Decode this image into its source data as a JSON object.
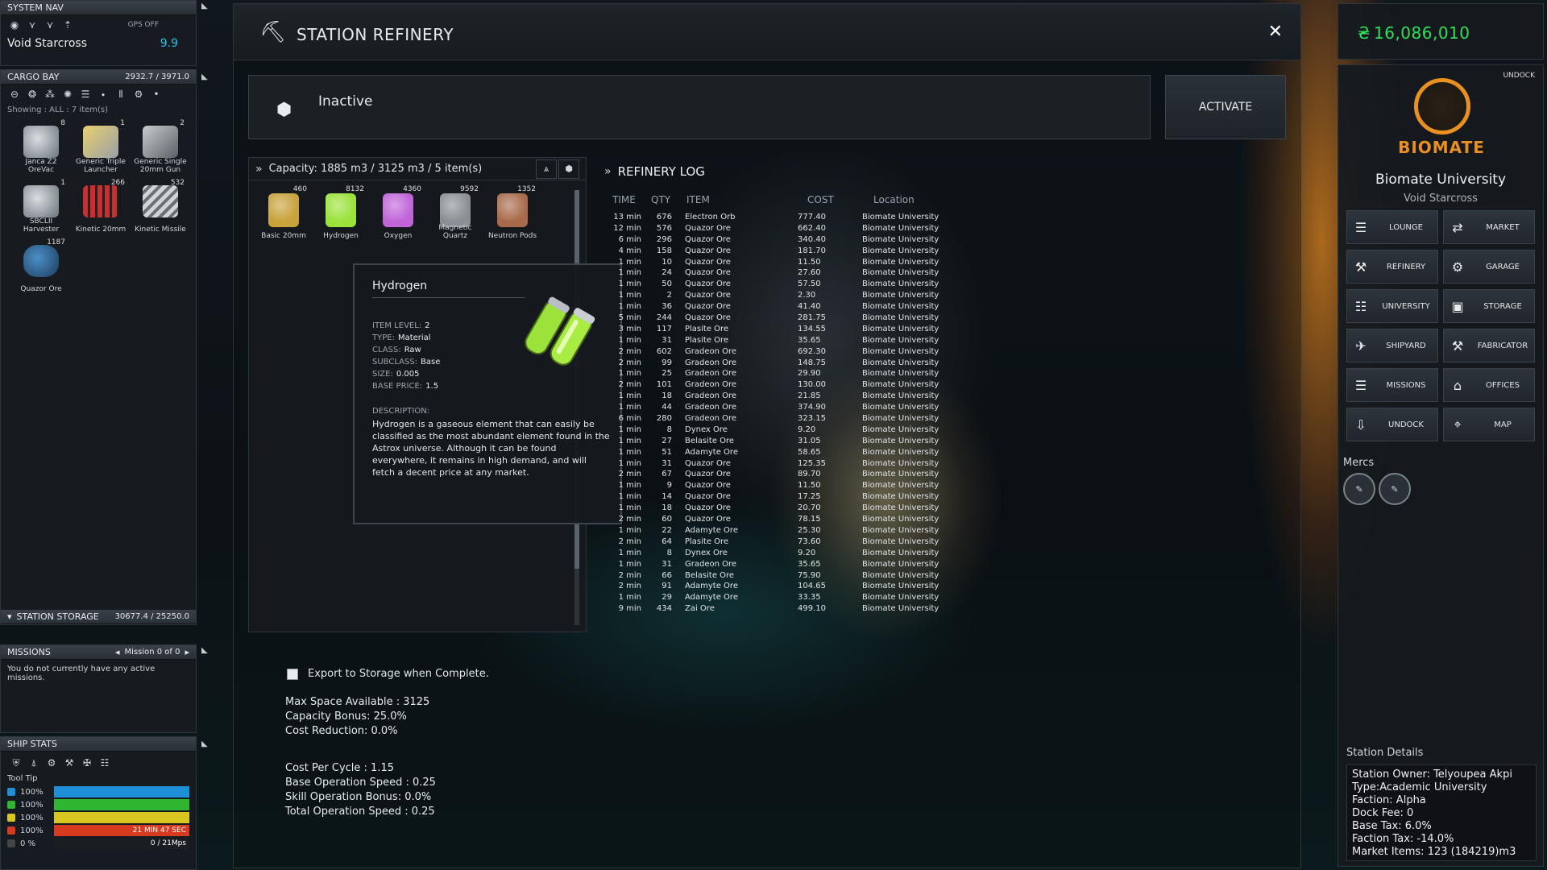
{
  "system_nav": {
    "title": "SYSTEM NAV",
    "gps": "GPS OFF",
    "location": "Void Starcross",
    "security": "9.9"
  },
  "cargo_bay": {
    "title": "CARGO BAY",
    "capacity": "2932.7 / 3971.0",
    "showing": "Showing : ALL : 7 item(s)",
    "items": [
      {
        "name": "Janca Z2 OreVac",
        "count": "8"
      },
      {
        "name": "Generic Triple Launcher",
        "count": "1"
      },
      {
        "name": "Generic Single 20mm Gun",
        "count": "2"
      },
      {
        "name": "SBCLII Harvester",
        "count": "1"
      },
      {
        "name": "Kinetic 20mm",
        "count": "266"
      },
      {
        "name": "Kinetic Missile",
        "count": "532"
      },
      {
        "name": "Quazor Ore",
        "count": "1187"
      }
    ]
  },
  "station_storage": {
    "title": "STATION STORAGE",
    "capacity": "30677.4 / 25250.0"
  },
  "missions": {
    "title": "MISSIONS",
    "counter": "Mission 0 of 0",
    "message": "You do not currently have any active missions."
  },
  "ship_stats": {
    "title": "SHIP STATS",
    "tooltip_label": "Tool Tip",
    "bars": [
      {
        "pct": "100%",
        "color": "#1f8fd8",
        "fill": 1.0,
        "text": ""
      },
      {
        "pct": "100%",
        "color": "#2fb52f",
        "fill": 1.0,
        "text": ""
      },
      {
        "pct": "100%",
        "color": "#d8c51f",
        "fill": 1.0,
        "text": ""
      },
      {
        "pct": "100%",
        "color": "#d63a1f",
        "fill": 1.0,
        "text": "21 MIN 47 SEC"
      },
      {
        "pct": "0 %",
        "color": "#444",
        "fill": 0.0,
        "text": "0 / 21Mps"
      }
    ]
  },
  "refinery": {
    "title": "STATION REFINERY",
    "status": "Inactive",
    "activate_label": "ACTIVATE",
    "capacity": "Capacity: 1885 m3 / 3125 m3 / 5 item(s)",
    "items": [
      {
        "name": "Basic 20mm",
        "count": "460",
        "color": "#c8a23a"
      },
      {
        "name": "Hydrogen",
        "count": "8132",
        "color": "#9be23a"
      },
      {
        "name": "Oxygen",
        "count": "4360",
        "color": "#c064d8"
      },
      {
        "name": "Magnetic Quartz",
        "count": "9592",
        "color": "#8a8f95"
      },
      {
        "name": "Neutron Pods",
        "count": "1352",
        "color": "#a86a4a"
      }
    ],
    "export_label": "Export to Storage when Complete.",
    "stats": [
      "Max Space Available : 3125",
      "Capacity Bonus: 25.0%",
      "Cost Reduction: 0.0%"
    ],
    "stats2": [
      "Cost Per Cycle : 1.15",
      "Base Operation Speed : 0.25",
      "Skill Operation Bonus: 0.0%",
      "Total Operation Speed : 0.25"
    ]
  },
  "tooltip": {
    "title": "Hydrogen",
    "fields": [
      {
        "k": "ITEM LEVEL:",
        "v": "2"
      },
      {
        "k": "TYPE:",
        "v": "Material"
      },
      {
        "k": "CLASS:",
        "v": "Raw"
      },
      {
        "k": "SUBCLASS:",
        "v": "Base"
      },
      {
        "k": "SIZE:",
        "v": "0.005"
      },
      {
        "k": "BASE PRICE:",
        "v": "1.5"
      }
    ],
    "desc_label": "DESCRIPTION:",
    "description": "Hydrogen is a gaseous element that can easily be classified as the most abundant element found in the Astrox universe. Although it can be found everywhere, it remains in high demand, and will fetch a decent price at any market."
  },
  "log": {
    "title": "REFINERY LOG",
    "headers": [
      "TIME",
      "QTY",
      "ITEM",
      "COST",
      "Location"
    ],
    "rows": [
      [
        "13 min",
        "676",
        "Electron Orb",
        "777.40",
        "Biomate University"
      ],
      [
        "12 min",
        "576",
        "Quazor Ore",
        "662.40",
        "Biomate University"
      ],
      [
        "6 min",
        "296",
        "Quazor Ore",
        "340.40",
        "Biomate University"
      ],
      [
        "4 min",
        "158",
        "Quazor Ore",
        "181.70",
        "Biomate University"
      ],
      [
        "1 min",
        "10",
        "Quazor Ore",
        "11.50",
        "Biomate University"
      ],
      [
        "1 min",
        "24",
        "Quazor Ore",
        "27.60",
        "Biomate University"
      ],
      [
        "1 min",
        "50",
        "Quazor Ore",
        "57.50",
        "Biomate University"
      ],
      [
        "1 min",
        "2",
        "Quazor Ore",
        "2.30",
        "Biomate University"
      ],
      [
        "1 min",
        "36",
        "Quazor Ore",
        "41.40",
        "Biomate University"
      ],
      [
        "5 min",
        "244",
        "Quazor Ore",
        "281.75",
        "Biomate University"
      ],
      [
        "3 min",
        "117",
        "Plasite Ore",
        "134.55",
        "Biomate University"
      ],
      [
        "1 min",
        "31",
        "Plasite Ore",
        "35.65",
        "Biomate University"
      ],
      [
        "2 min",
        "602",
        "Gradeon Ore",
        "692.30",
        "Biomate University"
      ],
      [
        "2 min",
        "99",
        "Gradeon Ore",
        "148.75",
        "Biomate University"
      ],
      [
        "1 min",
        "25",
        "Gradeon Ore",
        "29.90",
        "Biomate University"
      ],
      [
        "2 min",
        "101",
        "Gradeon Ore",
        "130.00",
        "Biomate University"
      ],
      [
        "1 min",
        "18",
        "Gradeon Ore",
        "21.85",
        "Biomate University"
      ],
      [
        "1 min",
        "44",
        "Gradeon Ore",
        "374.90",
        "Biomate University"
      ],
      [
        "6 min",
        "280",
        "Gradeon Ore",
        "323.15",
        "Biomate University"
      ],
      [
        "1 min",
        "8",
        "Dynex Ore",
        "9.20",
        "Biomate University"
      ],
      [
        "1 min",
        "27",
        "Belasite Ore",
        "31.05",
        "Biomate University"
      ],
      [
        "1 min",
        "51",
        "Adamyte Ore",
        "58.65",
        "Biomate University"
      ],
      [
        "1 min",
        "31",
        "Quazor Ore",
        "125.35",
        "Biomate University"
      ],
      [
        "2 min",
        "67",
        "Quazor Ore",
        "89.70",
        "Biomate University"
      ],
      [
        "1 min",
        "9",
        "Quazor Ore",
        "11.50",
        "Biomate University"
      ],
      [
        "1 min",
        "14",
        "Quazor Ore",
        "17.25",
        "Biomate University"
      ],
      [
        "1 min",
        "18",
        "Quazor Ore",
        "20.70",
        "Biomate University"
      ],
      [
        "2 min",
        "60",
        "Quazor Ore",
        "78.15",
        "Biomate University"
      ],
      [
        "1 min",
        "22",
        "Adamyte Ore",
        "25.30",
        "Biomate University"
      ],
      [
        "2 min",
        "64",
        "Plasite Ore",
        "73.60",
        "Biomate University"
      ],
      [
        "1 min",
        "8",
        "Dynex Ore",
        "9.20",
        "Biomate University"
      ],
      [
        "1 min",
        "31",
        "Gradeon Ore",
        "35.65",
        "Biomate University"
      ],
      [
        "2 min",
        "66",
        "Belasite Ore",
        "75.90",
        "Biomate University"
      ],
      [
        "2 min",
        "91",
        "Adamyte Ore",
        "104.65",
        "Biomate University"
      ],
      [
        "1 min",
        "29",
        "Adamyte Ore",
        "33.35",
        "Biomate University"
      ],
      [
        "9 min",
        "434",
        "Zai Ore",
        "499.10",
        "Biomate University"
      ]
    ]
  },
  "station": {
    "credits": "16,086,010",
    "undock_small": "UNDOCK",
    "logo_text": "BIOMATE",
    "name": "Biomate University",
    "system": "Void Starcross",
    "buttons": [
      {
        "label": "LOUNGE",
        "icon": "☰"
      },
      {
        "label": "MARKET",
        "icon": "⇄"
      },
      {
        "label": "REFINERY",
        "icon": "⚒"
      },
      {
        "label": "GARAGE",
        "icon": "⚙"
      },
      {
        "label": "UNIVERSITY",
        "icon": "☷"
      },
      {
        "label": "STORAGE",
        "icon": "▣"
      },
      {
        "label": "SHIPYARD",
        "icon": "✈"
      },
      {
        "label": "FABRICATOR",
        "icon": "⚒"
      },
      {
        "label": "MISSIONS",
        "icon": "☰"
      },
      {
        "label": "OFFICES",
        "icon": "⌂"
      },
      {
        "label": "UNDOCK",
        "icon": "⇩"
      },
      {
        "label": "MAP",
        "icon": "⌖"
      }
    ],
    "mercs_label": "Mercs",
    "details_label": "Station Details",
    "details": [
      "Station Owner: Telyoupea Akpi",
      "Type:Academic University",
      "Faction: Alpha",
      "Dock Fee: 0",
      "Base Tax: 6.0%",
      "Faction Tax: -14.0%",
      "Market Items: 123 (184219)m3"
    ]
  }
}
